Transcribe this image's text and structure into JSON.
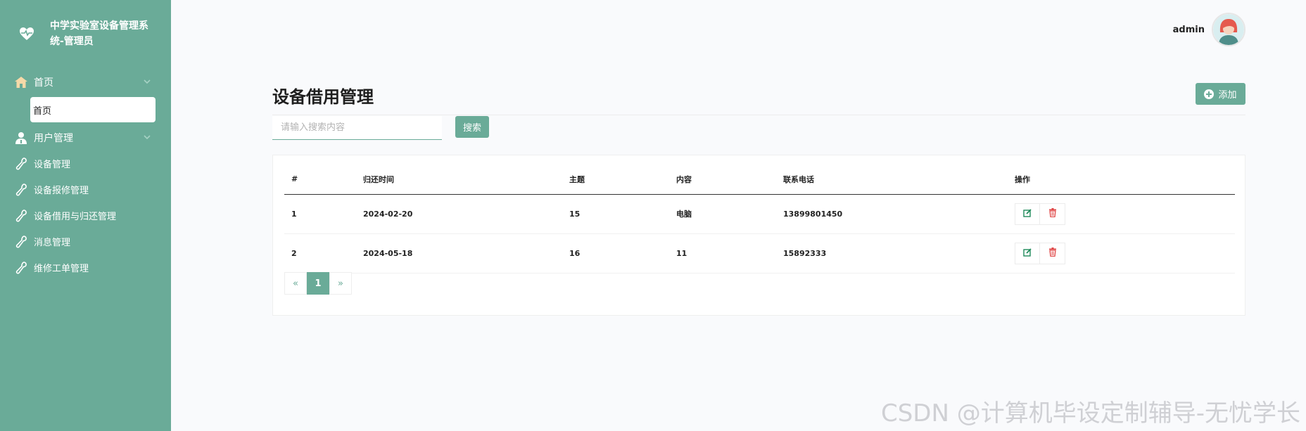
{
  "app": {
    "title": "中学实验室设备管理系统-管理员"
  },
  "sidebar": {
    "items": [
      {
        "label": "首页",
        "icon": "home-icon",
        "expandable": true
      },
      {
        "label": "首页",
        "sub": true,
        "active": true
      },
      {
        "label": "用户管理",
        "icon": "user-doctor-icon",
        "expandable": true
      },
      {
        "label": "设备管理",
        "icon": "wrench-icon"
      },
      {
        "label": "设备报修管理",
        "icon": "wrench-icon"
      },
      {
        "label": "设备借用与归还管理",
        "icon": "wrench-icon"
      },
      {
        "label": "消息管理",
        "icon": "wrench-icon"
      },
      {
        "label": "维修工单管理",
        "icon": "wrench-icon"
      }
    ]
  },
  "header": {
    "username": "admin"
  },
  "page": {
    "title": "设备借用管理",
    "add_label": "添加"
  },
  "search": {
    "placeholder": "请输入搜索内容",
    "value": "",
    "button_label": "搜索"
  },
  "table": {
    "columns": [
      "#",
      "归还时间",
      "主题",
      "内容",
      "联系电话",
      "操作"
    ],
    "rows": [
      {
        "id": "1",
        "return_time": "2024-02-20",
        "subject": "15",
        "content": "电脑",
        "phone": "13899801450"
      },
      {
        "id": "2",
        "return_time": "2024-05-18",
        "subject": "16",
        "content": "11",
        "phone": "15892333"
      }
    ]
  },
  "pagination": {
    "prev": "«",
    "current": "1",
    "next": "»"
  },
  "watermark": "CSDN @计算机毕设定制辅导-无忧学长",
  "colors": {
    "accent": "#6aab98",
    "edit": "#1e8a5a",
    "delete": "#e04848"
  }
}
